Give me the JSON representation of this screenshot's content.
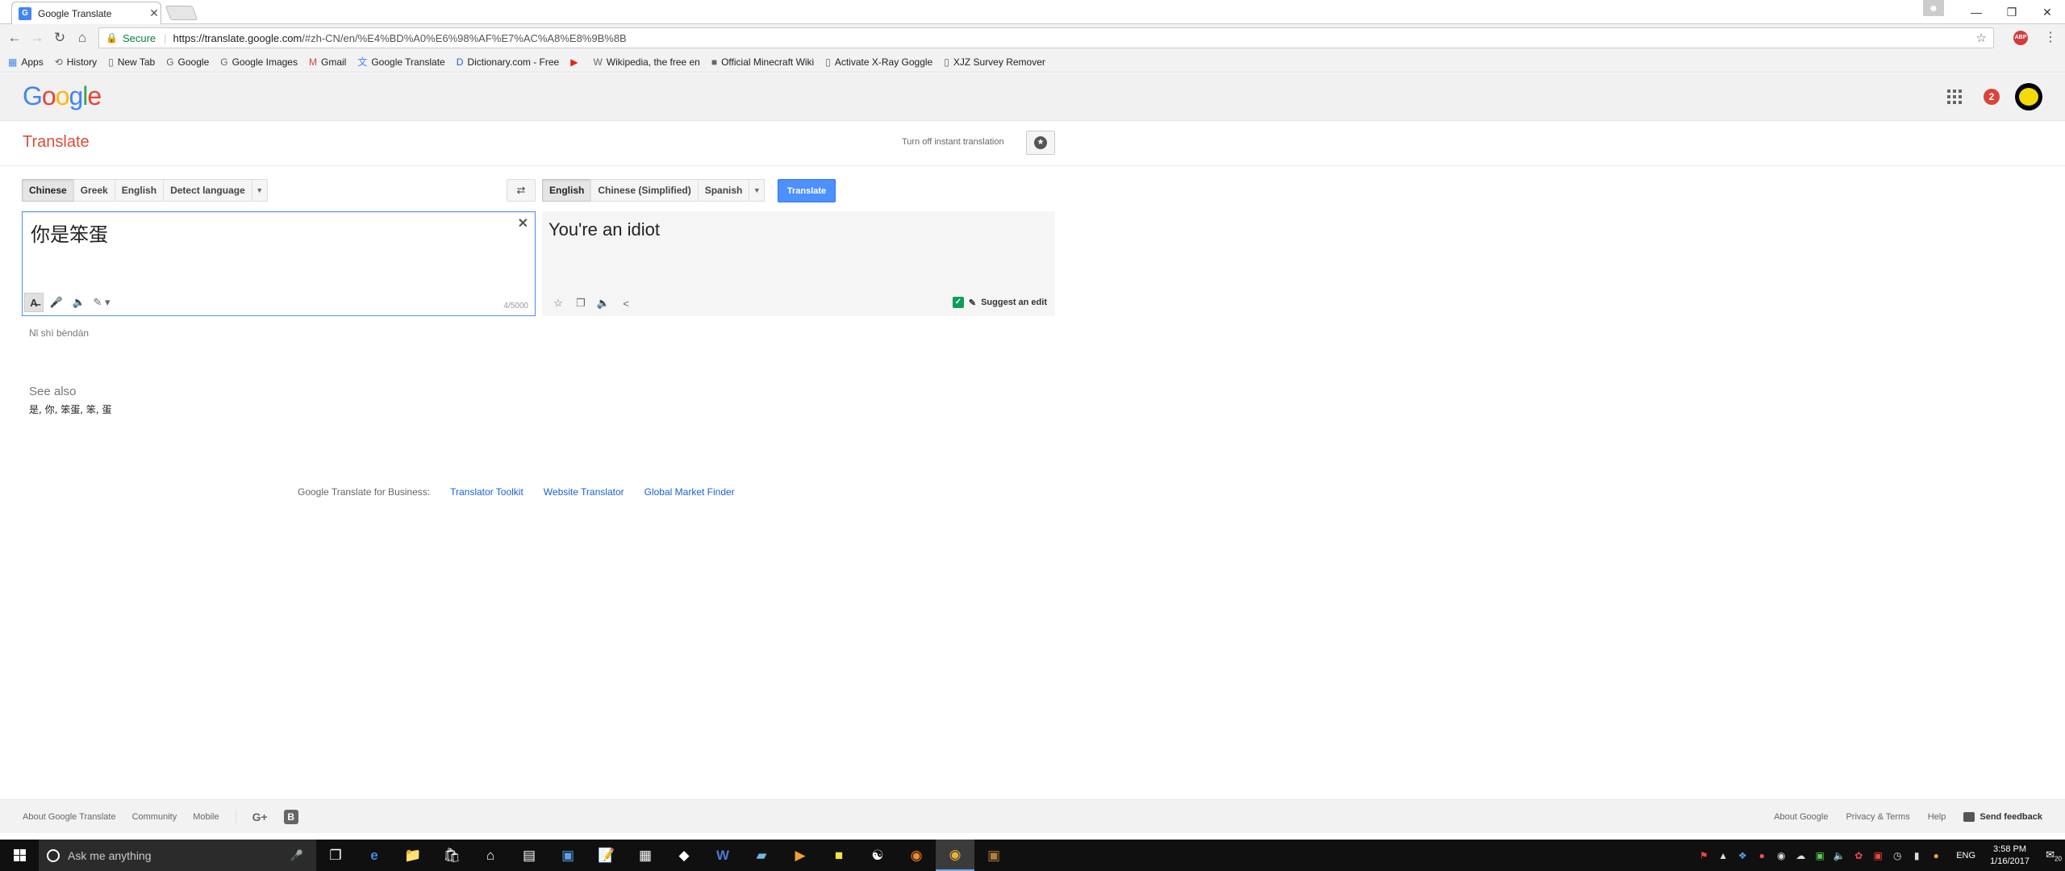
{
  "browser": {
    "tab_title": "Google Translate",
    "tab_favicon": "G",
    "window_controls": [
      "—",
      "❐",
      "✕"
    ],
    "secure_label": "Secure",
    "url_host": "https://translate.google.com",
    "url_path": "/#zh-CN/en/%E4%BD%A0%E6%98%AF%E7%AC%A8%E8%9B%8B",
    "bookmarks": [
      {
        "label": "Apps",
        "icon": "apps-grid-icon"
      },
      {
        "label": "History",
        "icon": "history-icon"
      },
      {
        "label": "New Tab",
        "icon": "page-icon"
      },
      {
        "label": "Google",
        "icon": "google-g-icon"
      },
      {
        "label": "Google Images",
        "icon": "google-g-icon"
      },
      {
        "label": "Gmail",
        "icon": "gmail-icon"
      },
      {
        "label": "Google Translate",
        "icon": "translate-icon"
      },
      {
        "label": "Dictionary.com - Free",
        "icon": "dictionary-icon"
      },
      {
        "label": "",
        "icon": "youtube-icon"
      },
      {
        "label": "Wikipedia, the free en",
        "icon": "wikipedia-icon"
      },
      {
        "label": "Official Minecraft Wiki",
        "icon": "minecraft-icon"
      },
      {
        "label": "Activate X-Ray Goggle",
        "icon": "page-icon"
      },
      {
        "label": "XJZ Survey Remover",
        "icon": "page-icon"
      }
    ]
  },
  "header": {
    "logo_letters": [
      {
        "ch": "G",
        "color": "#4285f4"
      },
      {
        "ch": "o",
        "color": "#ea4335"
      },
      {
        "ch": "o",
        "color": "#fbbc05"
      },
      {
        "ch": "g",
        "color": "#4285f4"
      },
      {
        "ch": "l",
        "color": "#34a853"
      },
      {
        "ch": "e",
        "color": "#ea4335"
      }
    ],
    "notification_count": "2"
  },
  "subheader": {
    "title": "Translate",
    "instant_label": "Turn off instant translation"
  },
  "source": {
    "languages": [
      "Chinese",
      "Greek",
      "English",
      "Detect language"
    ],
    "selected": "Chinese",
    "text": "你是笨蛋",
    "char_count": "4/5000",
    "transliteration": "Nǐ shì bèndàn"
  },
  "target": {
    "languages": [
      "English",
      "Chinese (Simplified)",
      "Spanish"
    ],
    "selected": "English",
    "translate_button": "Translate",
    "text": "You're an idiot",
    "suggest_edit": "Suggest an edit"
  },
  "see_also": {
    "heading": "See also",
    "words": "是, 你, 笨蛋, 笨, 蛋"
  },
  "business": {
    "label": "Google Translate for Business:",
    "links": [
      "Translator Toolkit",
      "Website Translator",
      "Global Market Finder"
    ]
  },
  "footer": {
    "left_links": [
      "About Google Translate",
      "Community",
      "Mobile"
    ],
    "gplus": "G+",
    "blogger": "B",
    "right_links": [
      "About Google",
      "Privacy & Terms",
      "Help"
    ],
    "feedback": "Send feedback"
  },
  "taskbar": {
    "search_placeholder": "Ask me anything",
    "language": "ENG",
    "time": "3:58 PM",
    "date": "1/16/2017",
    "notification_count": "20"
  }
}
